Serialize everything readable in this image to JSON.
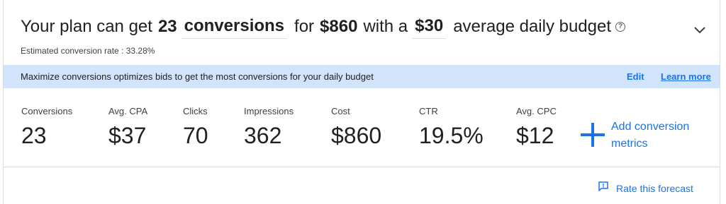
{
  "headline": {
    "prefix": "Your plan can get",
    "conversions_count": "23",
    "conversions_metric": "conversions",
    "for_text": "for",
    "cost": "$860",
    "with_text": "with a",
    "daily_budget": "$30",
    "suffix": "average daily budget",
    "help_icon": "help-circle-icon",
    "help_glyph": "?"
  },
  "estimate": {
    "text": "Estimated conversion rate : 33.28%"
  },
  "banner": {
    "message": "Maximize conversions optimizes bids to get the most conversions for your daily budget",
    "edit_label": "Edit",
    "learn_more_label": "Learn more",
    "background": "#d2e3fc"
  },
  "metrics": [
    {
      "label": "Conversions",
      "value": "23"
    },
    {
      "label": "Avg. CPA",
      "value": "$37"
    },
    {
      "label": "Clicks",
      "value": "70"
    },
    {
      "label": "Impressions",
      "value": "362"
    },
    {
      "label": "Cost",
      "value": "$860"
    },
    {
      "label": "CTR",
      "value": "19.5%"
    },
    {
      "label": "Avg. CPC",
      "value": "$12"
    }
  ],
  "add_metrics": {
    "label": "Add conversion metrics",
    "icon": "plus-icon"
  },
  "footer": {
    "rate_label": "Rate this forecast",
    "rate_icon": "feedback-icon"
  },
  "colors": {
    "accent": "#1a73e8",
    "text": "#202124"
  }
}
